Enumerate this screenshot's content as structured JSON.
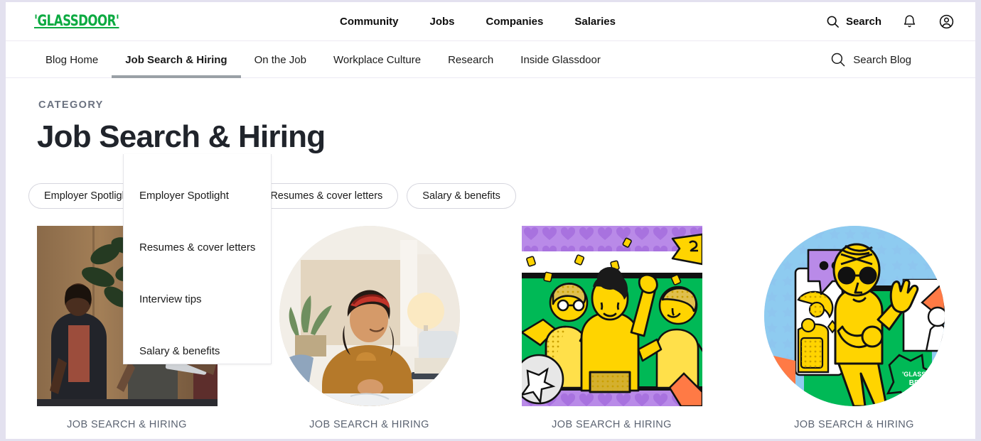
{
  "brand": {
    "logo_text": "'GLASSDOOR'",
    "logo_color": "#0caa41"
  },
  "topnav": {
    "links": [
      {
        "label": "Community"
      },
      {
        "label": "Jobs"
      },
      {
        "label": "Companies"
      },
      {
        "label": "Salaries"
      }
    ],
    "search_label": "Search",
    "search_icon": "search-icon",
    "notifications_icon": "bell-icon",
    "account_icon": "user-circle-icon"
  },
  "subnav": {
    "items": [
      {
        "label": "Blog Home",
        "active": false
      },
      {
        "label": "Job Search & Hiring",
        "active": true
      },
      {
        "label": "On the Job",
        "active": false
      },
      {
        "label": "Workplace Culture",
        "active": false
      },
      {
        "label": "Research",
        "active": false
      },
      {
        "label": "Inside Glassdoor",
        "active": false
      }
    ],
    "search_blog_label": "Search Blog",
    "search_blog_icon": "search-icon"
  },
  "dropdown": {
    "open_for": "Job Search & Hiring",
    "items": [
      {
        "label": "Employer Spotlight"
      },
      {
        "label": "Resumes & cover letters"
      },
      {
        "label": "Interview tips"
      },
      {
        "label": "Salary & benefits"
      }
    ]
  },
  "hero": {
    "eyebrow": "CATEGORY",
    "title": "Job Search & Hiring"
  },
  "filters": {
    "pills": [
      {
        "label": "Employer Spotlight"
      },
      {
        "label": "Interview tips"
      },
      {
        "label": "Resumes & cover letters"
      },
      {
        "label": "Salary & benefits"
      }
    ]
  },
  "cards": [
    {
      "caption": "JOB SEARCH & HIRING",
      "media": "photo-two-colleagues-office",
      "shape": "square"
    },
    {
      "caption": "JOB SEARCH & HIRING",
      "media": "photo-woman-smiling-at-desk",
      "shape": "circle"
    },
    {
      "caption": "JOB SEARCH & HIRING",
      "media": "illustration-people-celebrating",
      "shape": "square"
    },
    {
      "caption": "JOB SEARCH & HIRING",
      "media": "illustration-person-waving-best-places",
      "shape": "circle"
    }
  ],
  "colors": {
    "accent_green": "#0caa41",
    "illustration_yellow": "#ffd800",
    "illustration_green": "#00b050",
    "illustration_purple": "#b388e8",
    "text_primary": "#1b1b1b",
    "text_muted": "#5c6472",
    "page_border": "#e3e1ef"
  }
}
